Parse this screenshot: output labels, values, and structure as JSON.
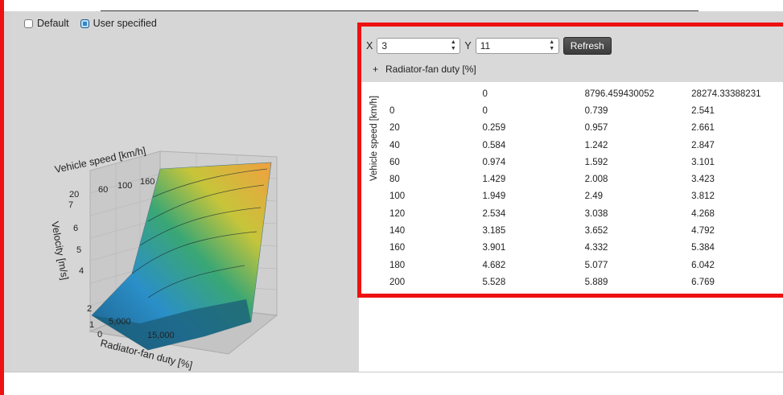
{
  "options": {
    "default_label": "Default",
    "user_label": "User specified"
  },
  "controls": {
    "x_label": "X",
    "x_value": "3",
    "y_label": "Y",
    "y_value": "11",
    "refresh_label": "Refresh"
  },
  "table": {
    "expander_symbol": "+",
    "column_group": "Radiator-fan duty [%]",
    "row_axis_label": "Vehicle speed [km/h]",
    "header": [
      "0",
      "8796.459430052",
      "28274.33388231"
    ],
    "rows": [
      [
        "0",
        "0",
        "0.739",
        "2.541"
      ],
      [
        "20",
        "0.259",
        "0.957",
        "2.661"
      ],
      [
        "40",
        "0.584",
        "1.242",
        "2.847"
      ],
      [
        "60",
        "0.974",
        "1.592",
        "3.101"
      ],
      [
        "80",
        "1.429",
        "2.008",
        "3.423"
      ],
      [
        "100",
        "1.949",
        "2.49",
        "3.812"
      ],
      [
        "120",
        "2.534",
        "3.038",
        "4.268"
      ],
      [
        "140",
        "3.185",
        "3.652",
        "4.792"
      ],
      [
        "160",
        "3.901",
        "4.332",
        "5.384"
      ],
      [
        "180",
        "4.682",
        "5.077",
        "6.042"
      ],
      [
        "200",
        "5.528",
        "5.889",
        "6.769"
      ]
    ]
  },
  "chart": {
    "vehicle_axis_label": "Vehicle speed [km/h]",
    "vehicle_ticks": [
      "20",
      "60",
      "100",
      "160"
    ],
    "velocity_axis_label": "Velocity [m/s]",
    "velocity_ticks": [
      "0",
      "1",
      "2",
      "4",
      "5",
      "6",
      "7"
    ],
    "fan_axis_label": "Radiator-fan duty [%]",
    "fan_ticks": [
      "5,000",
      "15,000"
    ]
  },
  "colors": {
    "accent_red": "#ee1111",
    "surface_start": "#1d5f8a",
    "surface_mid": "#3aa774",
    "surface_end": "#f0a040"
  }
}
